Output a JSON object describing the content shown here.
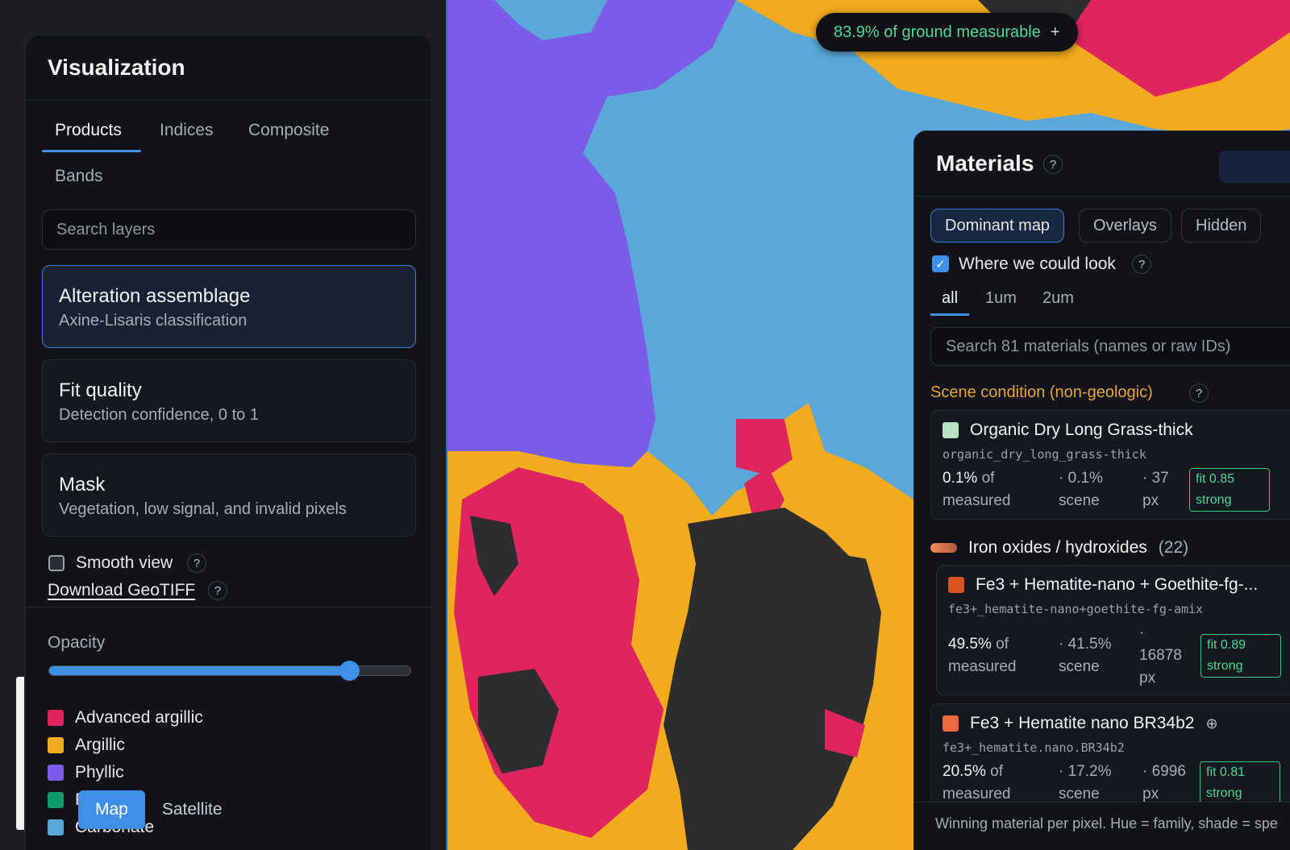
{
  "coverage": {
    "text": "83.9% of ground measurable",
    "action": "+"
  },
  "left_panel": {
    "title": "Visualization",
    "tabs": [
      "Products",
      "Indices",
      "Composite",
      "Bands"
    ],
    "search_placeholder": "Search layers",
    "layers": [
      {
        "title": "Alteration assemblage",
        "subtitle": "Axine-Lisaris classification",
        "selected": true
      },
      {
        "title": "Fit quality",
        "subtitle": "Detection confidence, 0 to 1",
        "selected": false
      },
      {
        "title": "Mask",
        "subtitle": "Vegetation, low signal, and invalid pixels",
        "selected": false
      }
    ],
    "smooth_view": {
      "label": "Smooth view",
      "checked": false
    },
    "download_label": "Download GeoTIFF",
    "help": "?",
    "opacity": {
      "label": "Opacity",
      "value": 0.83
    },
    "legend": [
      {
        "label": "Advanced argillic",
        "color": "#e0245e"
      },
      {
        "label": "Argillic",
        "color": "#f2ab1c"
      },
      {
        "label": "Phyllic",
        "color": "#7b5ce8"
      },
      {
        "label": "P",
        "color": "#109a6a"
      },
      {
        "label": "Carbonate",
        "color": "#5aa8d9"
      }
    ]
  },
  "map_toggle": {
    "map": "Map",
    "satellite": "Satellite",
    "active": "Map"
  },
  "right_panel": {
    "title": "Materials",
    "help": "?",
    "views": [
      "Dominant map",
      "Overlays",
      "Hidden"
    ],
    "where_label": "Where we could look",
    "bands": [
      "all",
      "1um",
      "2um"
    ],
    "search_placeholder": "Search 81 materials (names or raw IDs)",
    "scene_section": "Scene condition (non-geologic)",
    "family": {
      "name": "Iron oxides / hydroxides",
      "count": "(22)"
    },
    "materials": [
      {
        "name": "Organic Dry Long Grass-thick",
        "id": "organic_dry_long_grass-thick",
        "color": "#b9e4c3",
        "measured_pct": "0.1%",
        "measured_word": "of",
        "measured_unit": "measured",
        "scene": "· 0.1%",
        "scene_unit": "scene",
        "px": "· 37",
        "px_unit": "px",
        "fit": "fit 0.85",
        "fit_word": "strong"
      },
      {
        "name": "Fe3 + Hematite-nano + Goethite-fg-...",
        "id": "fe3+_hematite-nano+goethite-fg-amix",
        "color": "#d9541e",
        "measured_pct": "49.5%",
        "measured_word": "of",
        "measured_unit": "measured",
        "scene": "· 41.5%",
        "scene_unit": "scene",
        "px_dot": "·",
        "px": "16878",
        "px_unit": "px",
        "fit": "fit 0.89",
        "fit_word": "strong"
      },
      {
        "name": "Fe3 + Hematite nano BR34b2",
        "id": "fe3+_hematite.nano.BR34b2",
        "color": "#ee6a3c",
        "measured_pct": "20.5%",
        "measured_word": "of",
        "measured_unit": "measured",
        "scene": "· 17.2%",
        "scene_unit": "scene",
        "px": "· 6996",
        "px_unit": "px",
        "fit": "fit 0.81",
        "fit_word": "strong"
      }
    ],
    "footer": "Winning material per pixel. Hue = family, shade = spe"
  }
}
